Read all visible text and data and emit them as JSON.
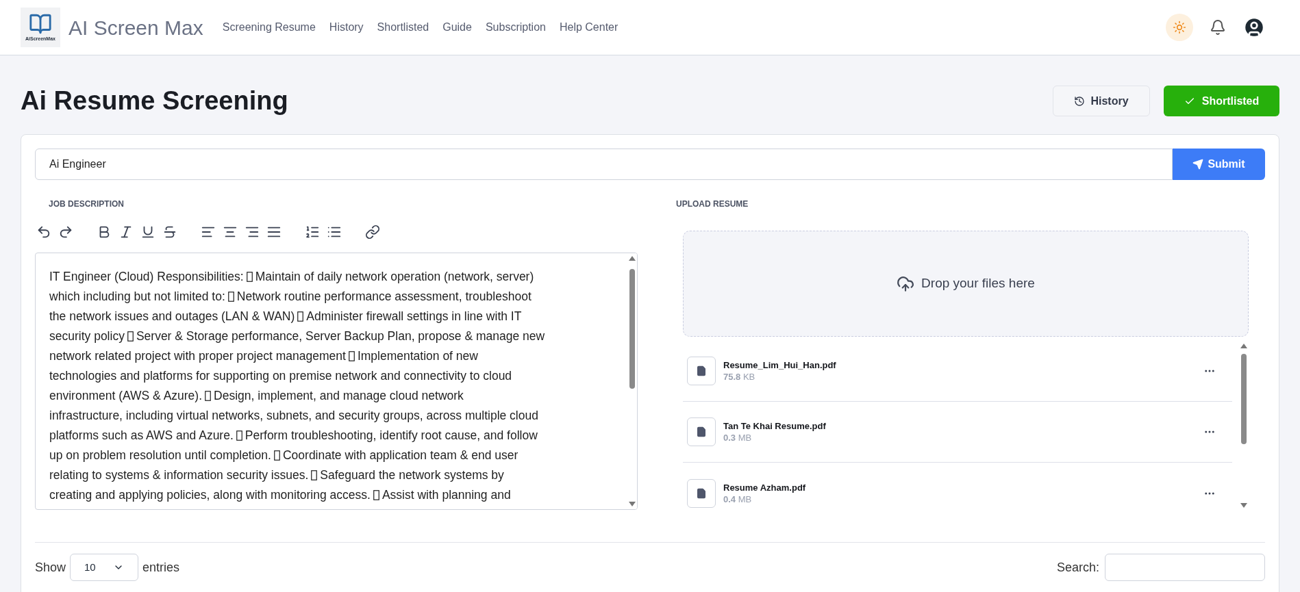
{
  "brand": {
    "logo_caption": "AiScreenMax",
    "name": "AI Screen Max"
  },
  "nav": [
    {
      "label": "Screening Resume"
    },
    {
      "label": "History"
    },
    {
      "label": "Shortlisted"
    },
    {
      "label": "Guide"
    },
    {
      "label": "Subscription"
    },
    {
      "label": "Help Center"
    }
  ],
  "page_title": "Ai Resume Screening",
  "header_buttons": [
    {
      "label": "History",
      "kind": "history"
    },
    {
      "label": "Shortlisted",
      "kind": "shortlisted"
    }
  ],
  "job_title_field": {
    "value": "Ai Engineer"
  },
  "submit_button": "Submit",
  "job_description": {
    "label": "JOB DESCRIPTION",
    "lines": [
      [
        "IT Engineer (Cloud) Responsibilities:",
        "Maintain of daily network operation (network, server)"
      ],
      [
        "which including but not limited to:",
        "Network routine performance assessment, troubleshoot"
      ],
      [
        "the network issues and outages (LAN & WAN)",
        "Administer firewall settings in line with IT"
      ],
      [
        "security policy",
        "Server & Storage performance, Server Backup Plan, propose & manage new"
      ],
      [
        "network related project with proper project management",
        "Implementation of new"
      ],
      [
        "technologies and platforms for supporting on premise network and connectivity to cloud"
      ],
      [
        "environment (AWS & Azure).",
        "Design, implement, and manage cloud network"
      ],
      [
        "infrastructure, including virtual networks, subnets, and security groups, across multiple cloud"
      ],
      [
        "platforms such as AWS and Azure.",
        "Perform troubleshooting, identify root cause, and follow"
      ],
      [
        "up on problem resolution until completion.",
        "Coordinate with application team & end user"
      ],
      [
        "relating to systems & information security issues.",
        "Safeguard the network systems by"
      ],
      [
        "creating and applying policies, along with monitoring access.",
        "Assist with planning and"
      ]
    ]
  },
  "upload": {
    "label": "UPLOAD RESUME",
    "drop_text": "Drop your files here"
  },
  "files": [
    {
      "name": "Resume_Lim_Hui_Han.pdf",
      "size": "75.8",
      "unit": "KB"
    },
    {
      "name": "Tan Te Khai Resume.pdf",
      "size": "0.3",
      "unit": "MB"
    },
    {
      "name": "Resume Azham.pdf",
      "size": "0.4",
      "unit": "MB"
    }
  ],
  "table_controls": {
    "show_label": "Show",
    "page_size": "10",
    "entries_label": "entries",
    "search_label": "Search:"
  }
}
